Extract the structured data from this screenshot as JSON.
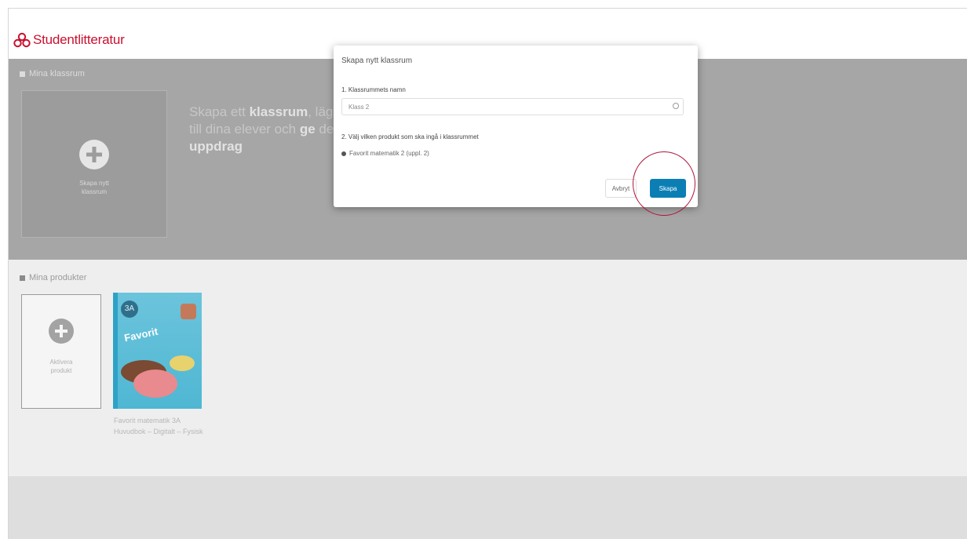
{
  "header": {
    "logo_text": "Studentlitteratur",
    "brand_color": "#c8102e"
  },
  "classrooms": {
    "section_label": "Mina klassrum",
    "create_card_caption_line1": "Skapa nytt",
    "create_card_caption_line2": "klassrum",
    "hero_text_1": "Skapa ett ",
    "hero_bold_1": "klassrum",
    "hero_text_2": ", lägg till dina elever och ",
    "hero_bold_2": "ge",
    "hero_text_3": " dem ",
    "hero_bold_3": "uppdrag"
  },
  "products": {
    "section_label": "Mina produkter",
    "add_caption_line1": "Aktivera",
    "add_caption_line2": "produkt",
    "book_badge": "3A",
    "book_title": "Favorit",
    "book_caption": "Favorit matematik 3A Huvudbok – Digitalt – Fysisk"
  },
  "modal": {
    "title": "Skapa nytt klassrum",
    "field1_label": "1. Klassrummets namn",
    "name_value": "Klass 2",
    "field2_label": "2. Välj vilken produkt som ska ingå i klassrummet",
    "product_option": "Favorit matematik 2 (uppl. 2)",
    "cancel_label": "Avbryt",
    "create_label": "Skapa"
  },
  "colors": {
    "primary_button": "#0b7fb4",
    "highlight_ring": "#b0163a"
  }
}
